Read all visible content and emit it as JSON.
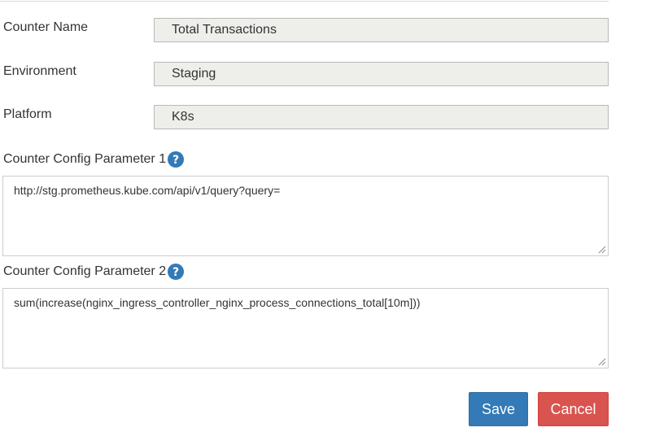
{
  "form": {
    "counter_name": {
      "label": "Counter Name",
      "value": "Total Transactions"
    },
    "environment": {
      "label": "Environment",
      "value": "Staging"
    },
    "platform": {
      "label": "Platform",
      "value": "K8s"
    },
    "param1": {
      "label": "Counter Config Parameter 1",
      "value": "http://stg.prometheus.kube.com/api/v1/query?query="
    },
    "param2": {
      "label": "Counter Config Parameter 2",
      "value": "sum(increase(nginx_ingress_controller_nginx_process_connections_total[10m]))"
    }
  },
  "actions": {
    "save_label": "Save",
    "cancel_label": "Cancel"
  },
  "colors": {
    "primary": "#337ab7",
    "danger": "#d9534f",
    "readonly_bg": "#eeeeea",
    "help_icon": "#337ab7"
  },
  "icons": {
    "help": "question-circle-icon",
    "resize": "resize-grip-icon"
  }
}
